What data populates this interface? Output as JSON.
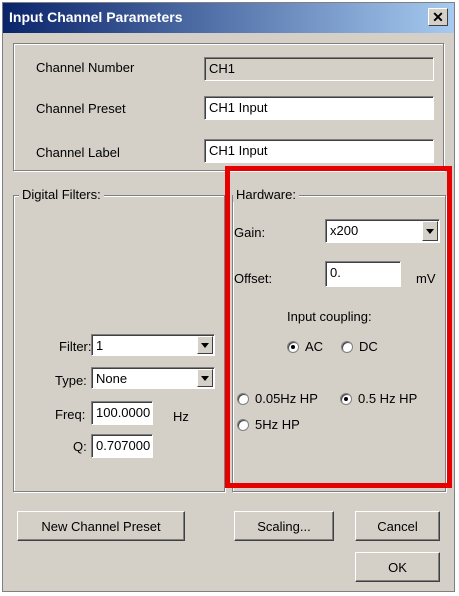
{
  "window": {
    "title": "Input Channel Parameters"
  },
  "channel": {
    "number_label": "Channel Number",
    "number_value": "CH1",
    "preset_label": "Channel Preset",
    "preset_value": "CH1 Input",
    "label_label": "Channel Label",
    "label_value": "CH1 Input"
  },
  "digital_filters": {
    "legend": "Digital Filters:",
    "filter_label": "Filter:",
    "filter_value": "1",
    "type_label": "Type:",
    "type_value": "None",
    "freq_label": "Freq:",
    "freq_value": "100.0000",
    "freq_unit": "Hz",
    "q_label": "Q:",
    "q_value": "0.707000"
  },
  "hardware": {
    "legend": "Hardware:",
    "gain_label": "Gain:",
    "gain_value": "x200",
    "offset_label": "Offset:",
    "offset_value": "0.",
    "offset_unit": "mV",
    "coupling_label": "Input coupling:",
    "ac_label": "AC",
    "dc_label": "DC",
    "hp005_label": "0.05Hz HP",
    "hp05_label": "0.5 Hz HP",
    "hp5_label": "5Hz HP",
    "coupling_selected": "AC",
    "hp_selected": "0.5 Hz HP"
  },
  "buttons": {
    "new_preset": "New Channel Preset",
    "scaling": "Scaling...",
    "cancel": "Cancel",
    "ok": "OK"
  },
  "colors": {
    "highlight": "#e60000",
    "titlebar": "#0a246a",
    "face": "#d4d0c8"
  }
}
